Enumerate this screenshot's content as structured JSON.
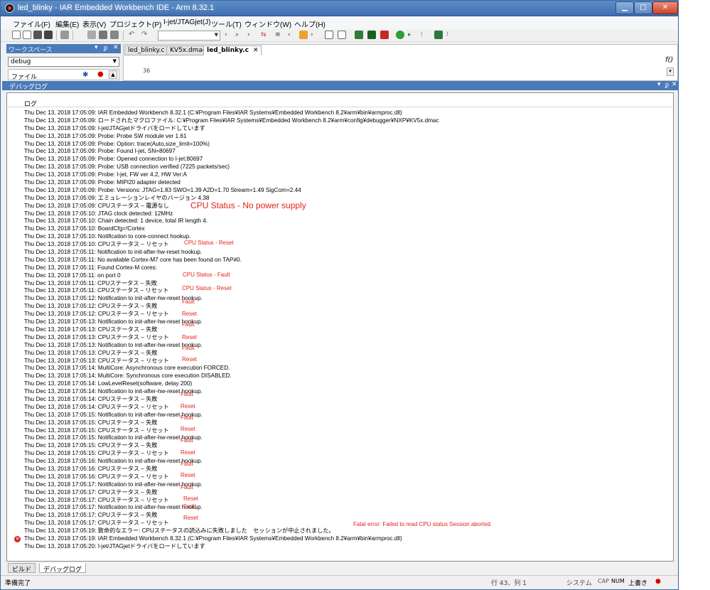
{
  "window": {
    "title": "led_blinky - IAR Embedded Workbench IDE - Arm 8.32.1"
  },
  "menu": [
    "ファイル(F)",
    "編集(E)",
    "表示(V)",
    "プロジェクト(P)",
    "I-jet/JTAGjet(J)",
    "ツール(T)",
    "ウィンドウ(W)",
    "ヘルプ(H)"
  ],
  "toolbar": {
    "icons": [
      "new-file-icon",
      "open-icon",
      "save-icon",
      "save-all-icon",
      "print-icon",
      "cut-icon",
      "copy-icon",
      "paste-icon",
      "undo-icon",
      "redo-icon",
      "find-icon",
      "bookmark-icon",
      "compile-icon",
      "make-icon",
      "debug-icon",
      "go-icon"
    ]
  },
  "workspace": {
    "title": "ワークスペース",
    "config": "debug",
    "files_label": "ファイル"
  },
  "editor": {
    "tabs": [
      "led_blinky.c",
      "KV5x.dmac",
      "led_blinky.c"
    ],
    "line_number": "36",
    "function_icon": "f()"
  },
  "debug_log": {
    "title": "デバッグログ",
    "column": "ログ",
    "lines": [
      "Thu Dec 13, 2018 17:05:09: IAR Embedded Workbench 8.32.1 (C:¥Program Files¥IAR Systems¥Embedded Workbench 8.2¥arm¥bin¥armproc.dll)",
      "Thu Dec 13, 2018 17:05:09: ロードされたマクロファイル: C:¥Program Files¥IAR Systems¥Embedded Workbench 8.2¥arm¥config¥debugger¥NXP¥KV5x.dmac",
      "Thu Dec 13, 2018 17:05:09: I-jet/JTAGjetドライバをロードしています",
      "Thu Dec 13, 2018 17:05:09: Probe: Probe SW module ver 1.61",
      "Thu Dec 13, 2018 17:05:09: Probe: Option: trace(Auto,size_limit=100%)",
      "Thu Dec 13, 2018 17:05:09: Probe: Found I-jet, SN=80697",
      "Thu Dec 13, 2018 17:05:09: Probe: Opened connection to I-jet:80697",
      "Thu Dec 13, 2018 17:05:09: Probe: USB connection verified (7225 packets/sec)",
      "Thu Dec 13, 2018 17:05:09: Probe: I-jet, FW ver 4.2, HW Ver:A",
      "Thu Dec 13, 2018 17:05:09: Probe: MIPI20 adapter detected",
      "Thu Dec 13, 2018 17:05:09: Probe: Versions: JTAG=1.83 SWO=1.39 A2D=1.70 Stream=1.49 SigCom=2.44",
      "Thu Dec 13, 2018 17:05:09: エミュレーションレイヤのバージョン 4.38",
      "Thu Dec 13, 2018 17:05:09: CPUステータス – 電源なし",
      "Thu Dec 13, 2018 17:05:10: JTAG clock detected: 12MHz",
      "Thu Dec 13, 2018 17:05:10: Chain detected: 1 device, total IR length 4.",
      "Thu Dec 13, 2018 17:05:10:  BoardCfg=!Cortex",
      "Thu Dec 13, 2018 17:05:10: Notification to core-connect hookup.",
      "Thu Dec 13, 2018 17:05:10: CPUステータス – リセット",
      "Thu Dec 13, 2018 17:05:11: Notification to init-after-hw-reset hookup.",
      "Thu Dec 13, 2018 17:05:11: No available Cortex-M7 core has been found on TAP#0.",
      "Thu Dec 13, 2018 17:05:11: Found Cortex-M cores:",
      "Thu Dec 13, 2018 17:05:11:    on port 0",
      "Thu Dec 13, 2018 17:05:11: CPUステータス – 失敗",
      "Thu Dec 13, 2018 17:05:11: CPUステータス – リセット",
      "Thu Dec 13, 2018 17:05:12: Notification to init-after-hw-reset hookup.",
      "Thu Dec 13, 2018 17:05:12: CPUステータス – 失敗",
      "Thu Dec 13, 2018 17:05:12: CPUステータス – リセット",
      "Thu Dec 13, 2018 17:05:13: Notification to init-after-hw-reset hookup.",
      "Thu Dec 13, 2018 17:05:13: CPUステータス – 失敗",
      "Thu Dec 13, 2018 17:05:13: CPUステータス – リセット",
      "Thu Dec 13, 2018 17:05:13: Notification to init-after-hw-reset hookup.",
      "Thu Dec 13, 2018 17:05:13: CPUステータス – 失敗",
      "Thu Dec 13, 2018 17:05:13: CPUステータス – リセット",
      "Thu Dec 13, 2018 17:05:14: MultiCore: Asynchronous core execution FORCED.",
      "Thu Dec 13, 2018 17:05:14: MultiCore: Synchronous core execution DISABLED.",
      "Thu Dec 13, 2018 17:05:14: LowLevelReset(software, delay 200)",
      "Thu Dec 13, 2018 17:05:14: Notification to init-after-hw-reset hookup.",
      "Thu Dec 13, 2018 17:05:14: CPUステータス – 失敗",
      "Thu Dec 13, 2018 17:05:14: CPUステータス – リセット",
      "Thu Dec 13, 2018 17:05:15: Notification to init-after-hw-reset hookup.",
      "Thu Dec 13, 2018 17:05:15: CPUステータス – 失敗",
      "Thu Dec 13, 2018 17:05:15: CPUステータス – リセット",
      "Thu Dec 13, 2018 17:05:15: Notification to init-after-hw-reset hookup.",
      "Thu Dec 13, 2018 17:05:15: CPUステータス – 失敗",
      "Thu Dec 13, 2018 17:05:15: CPUステータス – リセット",
      "Thu Dec 13, 2018 17:05:16: Notification to init-after-hw-reset hookup.",
      "Thu Dec 13, 2018 17:05:16: CPUステータス – 失敗",
      "Thu Dec 13, 2018 17:05:16: CPUステータス – リセット",
      "Thu Dec 13, 2018 17:05:17: Notification to init-after-hw-reset hookup.",
      "Thu Dec 13, 2018 17:05:17: CPUステータス – 失敗",
      "Thu Dec 13, 2018 17:05:17: CPUステータス – リセット",
      "Thu Dec 13, 2018 17:05:17: Notification to init-after-hw-reset hookup.",
      "Thu Dec 13, 2018 17:05:17: CPUステータス – 失敗",
      "Thu Dec 13, 2018 17:05:17: CPUステータス – リセット",
      "Thu Dec 13, 2018 17:05:19: 致命的なエラー: CPUステータスの読込みに失敗しました　セッションが中止されました。",
      "Thu Dec 13, 2018 17:05:19: IAR Embedded Workbench 8.32.1 (C:¥Program Files¥IAR Systems¥Embedded Workbench 8.2¥arm¥bin¥armproc.dll)",
      "Thu Dec 13, 2018 17:05:20: I-jet/JTAGjetドライバをロードしています"
    ],
    "error_line_index": 55
  },
  "annotations": {
    "no_power": "CPU Status - No power supply",
    "reset_1": "CPU Status - Reset",
    "fault_1": "CPU Status - Fault",
    "reset_2": "CPU Status - Reset",
    "fault": "Fault",
    "reset": "Reset",
    "fatal": "Fatal error: Failed to read CPU status Session aborted."
  },
  "bottom_tabs": [
    "ビルド",
    "デバッグログ"
  ],
  "statusbar": {
    "ready": "準備完了",
    "position": "行 43、列 1",
    "system": "システム",
    "cap": "CAP",
    "num": "NUM",
    "insert": "上書き"
  },
  "colors": {
    "titlebar": "#4a7ab8",
    "annotation": "#e2231a",
    "error_icon": "#d22222"
  }
}
